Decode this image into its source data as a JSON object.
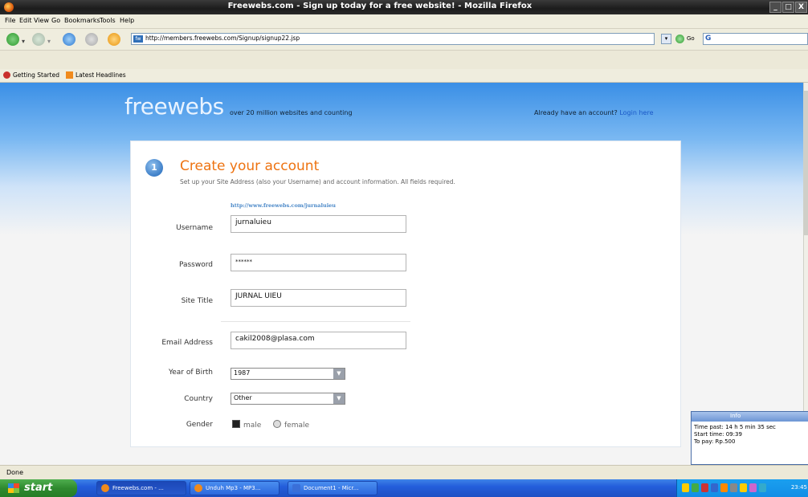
{
  "window": {
    "title": "Freewebs.com - Sign up today for a free website! - Mozilla Firefox",
    "controls": [
      "_",
      "□",
      "X"
    ]
  },
  "menu": [
    "File",
    "Edit",
    "View",
    "Go",
    "Bookmarks",
    "Tools",
    "Help"
  ],
  "toolbar": {
    "url": "http://members.freewebs.com/Signup/signup22.jsp",
    "go_label": "Go",
    "search_engine": "G"
  },
  "bookmarks": [
    "Getting Started",
    "Latest Headlines"
  ],
  "page": {
    "logo": "freewebs",
    "tagline": "over 20 million websites and counting",
    "login_prompt": "Already have an account?",
    "login_link": "Login here",
    "step_number": "1",
    "heading": "Create your account",
    "subheading": "Set up your Site Address (also your Username) and account information. All fields required.",
    "site_url": "http://www.freewebs.com/jurnaluieu",
    "form": {
      "username": {
        "label": "Username",
        "value": "jurnaluieu"
      },
      "password": {
        "label": "Password",
        "value": "******"
      },
      "site_title": {
        "label": "Site Title",
        "value": "JURNAL UIEU"
      },
      "email": {
        "label": "Email Address",
        "value": "cakil2008@plasa.com"
      },
      "year_of_birth": {
        "label": "Year of Birth",
        "value": "1987"
      },
      "country": {
        "label": "Country",
        "value": "Other"
      },
      "gender": {
        "label": "Gender",
        "options": [
          "male",
          "female"
        ],
        "selected": "male"
      }
    }
  },
  "info_widget": {
    "title": "Info",
    "time_past": "Time past: 14 h 5 min 35 sec",
    "start_time": "Start time: 09:39",
    "to_pay": "To pay: Rp.500"
  },
  "status": "Done",
  "taskbar": {
    "start": "start",
    "tasks": [
      "Freewebs.com - ...",
      "Unduh Mp3 - MP3...",
      "Document1 - Micr..."
    ],
    "clock": "23:45"
  }
}
